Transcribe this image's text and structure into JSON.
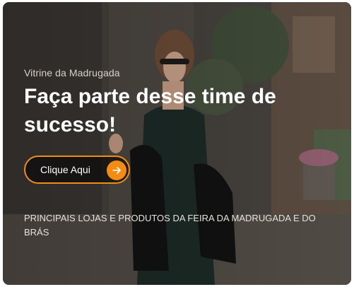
{
  "hero": {
    "eyebrow": "Vitrine da Madrugada",
    "headline": "Faça parte desse time de sucesso!",
    "cta_label": "Clique Aqui",
    "cta_icon": "arrow-right-icon",
    "tagline": "PRINCIPAIS LOJAS E PRODUTOS DA FEIRA DA MADRUGADA E DO BRÁS"
  },
  "colors": {
    "accent": "#f28c14",
    "overlay": "#2f2c2a",
    "headline": "#ffffff"
  }
}
